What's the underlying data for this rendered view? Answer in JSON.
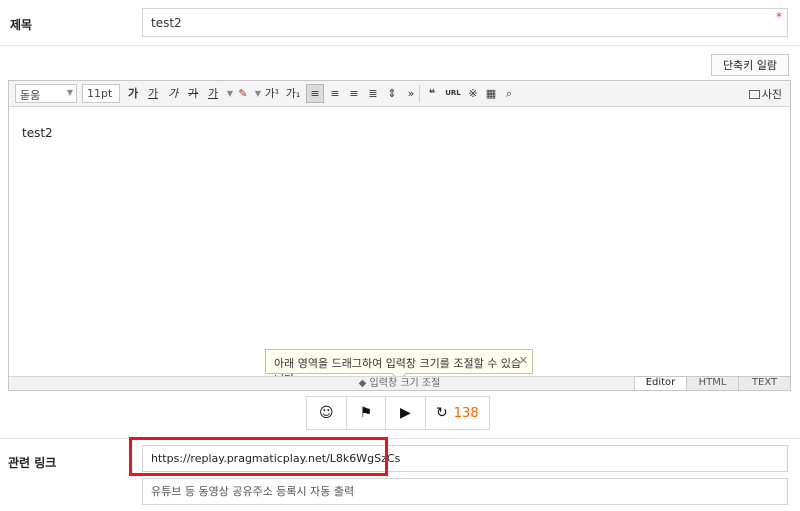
{
  "title_row": {
    "label": "제목",
    "value": "test2",
    "required_mark": "*"
  },
  "shortcut_button": {
    "label": "단축키 일람"
  },
  "toolbar": {
    "font": "돋움",
    "size": "11pt",
    "bold": "가",
    "underline": "가",
    "italic": "가",
    "strike": "가",
    "text_color": "가",
    "superscript": "가¹",
    "subscript": "가₁",
    "more": "»",
    "quote": "❝",
    "url": "URL",
    "photo": "사진"
  },
  "editor": {
    "content": "test2",
    "tooltip": "아래 영역을 드래그하여 입력창 크기를 조절할 수 있습니다.",
    "resize_label": "◆ 입력창 크기 조절",
    "tabs": [
      "Editor",
      "HTML",
      "TEXT"
    ]
  },
  "emoticon_bar": {
    "refresh_count": "138"
  },
  "link_row": {
    "label": "관련 링크",
    "value": "https://replay.pragmaticplay.net/L8k6WgSzCs",
    "video_placeholder": "유튜브 등 동영상 공유주소 등록시 자동 출력"
  },
  "colors": {
    "accent_red": "#e8151b",
    "count_orange": "#ff6600"
  }
}
